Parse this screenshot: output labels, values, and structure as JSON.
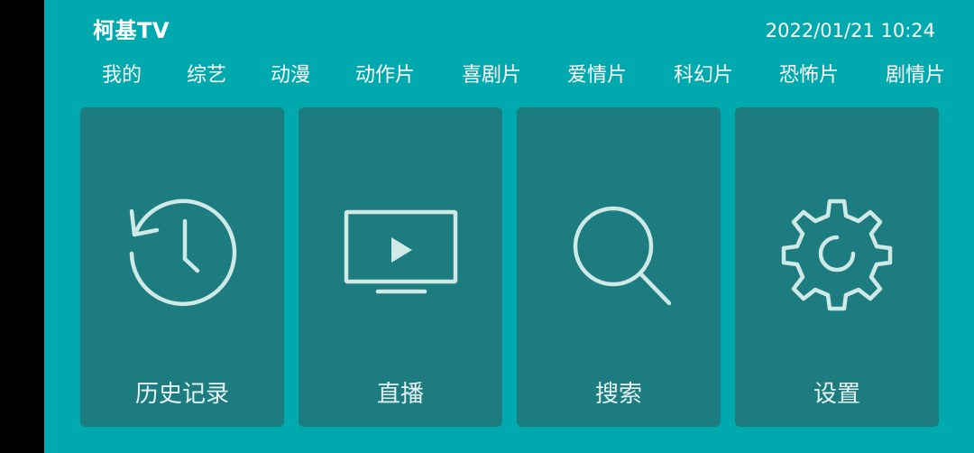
{
  "header": {
    "app_title": "柯基TV",
    "datetime": "2022/01/21 10:24"
  },
  "nav": {
    "items": [
      {
        "label": "我的"
      },
      {
        "label": "综艺"
      },
      {
        "label": "动漫"
      },
      {
        "label": "动作片"
      },
      {
        "label": "喜剧片"
      },
      {
        "label": "爱情片"
      },
      {
        "label": "科幻片"
      },
      {
        "label": "恐怖片"
      },
      {
        "label": "剧情片"
      }
    ]
  },
  "tiles": [
    {
      "label": "历史记录",
      "icon": "history-icon"
    },
    {
      "label": "直播",
      "icon": "live-tv-icon"
    },
    {
      "label": "搜索",
      "icon": "search-icon"
    },
    {
      "label": "设置",
      "icon": "settings-gear-icon"
    }
  ],
  "colors": {
    "background": "#00a9ad",
    "tile_background": "#1c7c7f",
    "icon_stroke": "#cfe9e7",
    "text": "#ffffff"
  }
}
